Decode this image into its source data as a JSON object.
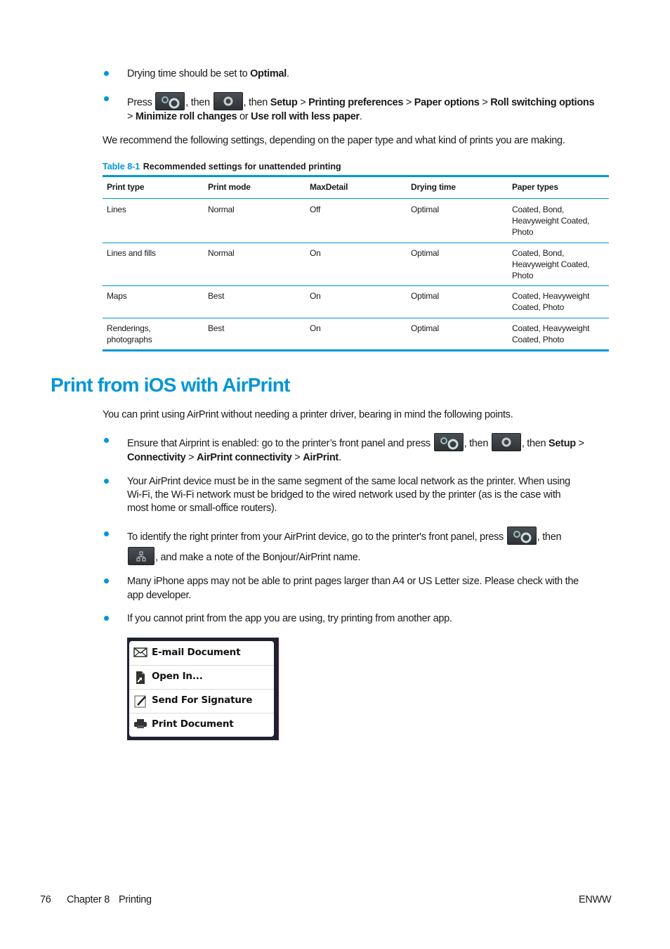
{
  "bullets_top": [
    {
      "parts": [
        {
          "t": "Drying time should be set to "
        },
        {
          "b": "Optimal"
        },
        {
          "t": "."
        }
      ]
    },
    {
      "line1": [
        {
          "t": "Press "
        },
        {
          "icon": "gears"
        },
        {
          "t": ", then "
        },
        {
          "icon": "gear"
        },
        {
          "t": ", then "
        },
        {
          "b": "Setup"
        },
        {
          "t": " > "
        },
        {
          "b": "Printing preferences"
        },
        {
          "t": " > "
        },
        {
          "b": "Paper options"
        },
        {
          "t": " > "
        },
        {
          "b": "Roll switching options"
        }
      ],
      "line2": [
        {
          "t": "> "
        },
        {
          "b": "Minimize roll changes"
        },
        {
          "t": " or "
        },
        {
          "b": "Use roll with less paper"
        },
        {
          "t": "."
        }
      ]
    }
  ],
  "recommend_text": "We recommend the following settings, depending on the paper type and what kind of prints you are making.",
  "table": {
    "label": "Table 8-1",
    "caption": "Recommended settings for unattended printing",
    "headers": [
      "Print type",
      "Print mode",
      "MaxDetail",
      "Drying time",
      "Paper types"
    ],
    "rows": [
      [
        [
          "Lines"
        ],
        [
          "Normal"
        ],
        [
          "Off"
        ],
        [
          "Optimal"
        ],
        [
          "Coated, Bond,",
          "Heavyweight Coated,",
          "Photo"
        ]
      ],
      [
        [
          "Lines and fills"
        ],
        [
          "Normal"
        ],
        [
          "On"
        ],
        [
          "Optimal"
        ],
        [
          "Coated, Bond,",
          "Heavyweight Coated,",
          "Photo"
        ]
      ],
      [
        [
          "Maps"
        ],
        [
          "Best"
        ],
        [
          "On"
        ],
        [
          "Optimal"
        ],
        [
          "Coated, Heavyweight",
          "Coated, Photo"
        ]
      ],
      [
        [
          "Renderings,",
          "photographs"
        ],
        [
          "Best"
        ],
        [
          "On"
        ],
        [
          "Optimal"
        ],
        [
          "Coated, Heavyweight",
          "Coated, Photo"
        ]
      ]
    ]
  },
  "section_title": "Print from iOS with AirPrint",
  "intro": "You can print using AirPrint without needing a printer driver, bearing in mind the following points.",
  "airprint_bullets": [
    {
      "lines": [
        [
          {
            "t": "Ensure that Airprint is enabled: go to the printer’s front panel and press "
          },
          {
            "icon": "gears"
          },
          {
            "t": ", then "
          },
          {
            "icon": "gear"
          },
          {
            "t": ", then "
          },
          {
            "b": "Setup"
          },
          {
            "t": " >"
          }
        ],
        [
          {
            "b": "Connectivity"
          },
          {
            "t": " > "
          },
          {
            "b": "AirPrint connectivity"
          },
          {
            "t": " > "
          },
          {
            "b": "AirPrint"
          },
          {
            "t": "."
          }
        ]
      ]
    },
    {
      "lines": [
        [
          {
            "t": "Your AirPrint device must be in the same segment of the same local network as the printer. When using"
          }
        ],
        [
          {
            "t": "Wi-Fi, the Wi-Fi network must be bridged to the wired network used by the printer (as is the case with"
          }
        ],
        [
          {
            "t": "most home or small-office routers)."
          }
        ]
      ]
    },
    {
      "lines": [
        [
          {
            "t": "To identify the right printer from your AirPrint device, go to the printer's front panel, press "
          },
          {
            "icon": "gears"
          },
          {
            "t": ", then"
          }
        ],
        [
          {
            "icon": "net"
          },
          {
            "t": ", and make a note of the Bonjour/AirPrint name."
          }
        ]
      ]
    },
    {
      "lines": [
        [
          {
            "t": "Many iPhone apps may not be able to print pages larger than A4 or US Letter size. Please check with the"
          }
        ],
        [
          {
            "t": "app developer."
          }
        ]
      ]
    },
    {
      "lines": [
        [
          {
            "t": "If you cannot print from the app you are using, try printing from another app."
          }
        ]
      ]
    }
  ],
  "share_menu": {
    "items": [
      {
        "label": "E-mail Document",
        "icon": "envelope-icon"
      },
      {
        "label": "Open In...",
        "icon": "document-arrow-icon"
      },
      {
        "label": "Send For Signature",
        "icon": "pen-signature-icon"
      },
      {
        "label": "Print Document",
        "icon": "printer-icon"
      }
    ]
  },
  "footer": {
    "page_number": "76",
    "chapter": "Chapter 8",
    "chapter_title": "Printing",
    "locale": "ENWW"
  },
  "colors": {
    "accent": "#0096d6"
  }
}
